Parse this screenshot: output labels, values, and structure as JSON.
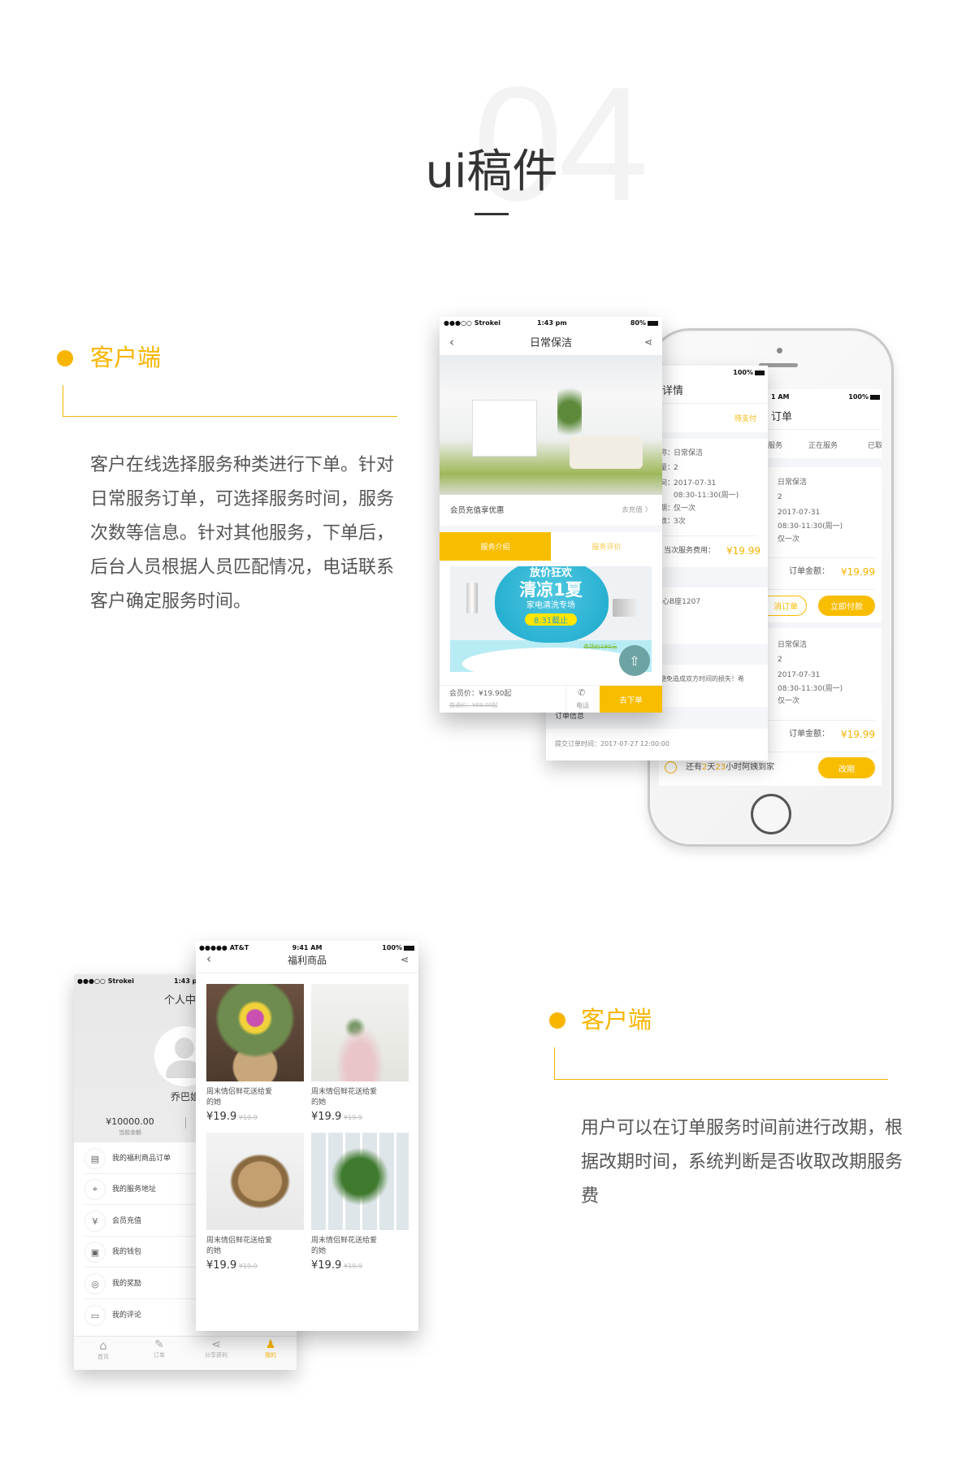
{
  "header": {
    "number": "04",
    "title": "ui稿件"
  },
  "accent_color": "#f8b500",
  "section1": {
    "label": "客户端",
    "description": "客户在线选择服务种类进行下单。针对日常服务订单，可选择服务时间，服务次数等信息。针对其他服务，下单后，后台人员根据人员匹配情况，电话联系客户确定服务时间。"
  },
  "section2": {
    "label": "客户端",
    "description": "用户可以在订单服务时间前进行改期，根据改期时间，系统判断是否收取改期服务费"
  },
  "service_phone": {
    "status": {
      "carrier": "●●●○○ Strokei",
      "time": "1:43 pm",
      "battery": "80%"
    },
    "title": "日常保洁",
    "promo_row": {
      "label": "会员充值享优惠",
      "action": "去充值 〉"
    },
    "tabs": [
      "服务介绍",
      "服务评价"
    ],
    "banner": {
      "line1": "放价狂欢",
      "line2": "清凉1夏",
      "line3": "家电清洗专场",
      "deadline": "8.31截止",
      "market_price": "市场价190元"
    },
    "bottom": {
      "member_price": "会员价：¥19.90起",
      "normal_price": "普通价：¥69.00起",
      "phone_label": "电话",
      "order_button": "去下单"
    }
  },
  "detail_phone": {
    "status": {
      "time": "AM",
      "battery": "100%"
    },
    "title": "详情",
    "state": "待支付",
    "fields": [
      {
        "label": "称：",
        "value": "日常保洁"
      },
      {
        "label": "量：",
        "value": "2"
      },
      {
        "label": "间：",
        "value": "2017-07-31"
      },
      {
        "label": "",
        "value": "08:30-11:30(周一)"
      },
      {
        "label": "期：",
        "value": "仅一次"
      },
      {
        "label": "数：",
        "value": "3次"
      }
    ],
    "fee_label": "当次服务费用：",
    "fee": "¥19.99",
    "address": "心B座1207",
    "notice": "避免造成双方时间的损失！希",
    "order_info_label": "订单信息",
    "submit_time": "提交订单时间：2017-07-27  12:00:00"
  },
  "orders_phone": {
    "status": {
      "time": "1 AM",
      "battery": "100%"
    },
    "title": "订单",
    "tabs": [
      "服务",
      "正在服务",
      "已取"
    ],
    "orders": [
      {
        "fields": [
          "日常保洁",
          "2",
          "2017-07-31",
          "08:30-11:30(周一)",
          "仅一次"
        ],
        "amount_label": "订单金额：",
        "amount": "¥19.99",
        "buttons": [
          "消订单",
          "立即付款"
        ]
      },
      {
        "fields": [
          "日常保洁",
          "2",
          "2017-07-31",
          "08:30-11:30(周一)",
          "仅一次"
        ],
        "amount_label": "订单金额：",
        "amount": "¥19.99",
        "countdown": {
          "pre": "还有",
          "days": "2",
          "mid": "天",
          "hours": "23",
          "post": "小时阿姨到家"
        },
        "button": "改期"
      }
    ]
  },
  "profile_phone": {
    "status": {
      "carrier": "●●●○○ Strokei",
      "time": "1:43 pm"
    },
    "title": "个人中心",
    "name": "乔巴姐",
    "balance": "¥10000.00",
    "balance_label": "当前余额",
    "menu": [
      {
        "icon": "clipboard-icon",
        "label": "我的福利商品订单"
      },
      {
        "icon": "location-icon",
        "label": "我的服务地址"
      },
      {
        "icon": "yen-icon",
        "label": "会员充值"
      },
      {
        "icon": "wallet-icon",
        "label": "我的钱包"
      },
      {
        "icon": "coins-icon",
        "label": "我的奖励"
      },
      {
        "icon": "comment-icon",
        "label": "我的评论"
      }
    ],
    "tabbar": [
      {
        "label": "首页",
        "icon": "home-icon"
      },
      {
        "label": "订单",
        "icon": "order-icon"
      },
      {
        "label": "分享获利",
        "icon": "share-icon"
      },
      {
        "label": "我的",
        "icon": "user-icon",
        "active": true
      }
    ]
  },
  "goods_phone": {
    "status": {
      "carrier": "●●●●● AT&T",
      "time": "9:41 AM",
      "battery": "100%"
    },
    "title": "福利商品",
    "items": [
      {
        "line1": "周末情侣鲜花送给爱",
        "line2": "的她",
        "price": "¥19.9",
        "old_price": "¥19.9"
      },
      {
        "line1": "周末情侣鲜花送给爱",
        "line2": "的她",
        "price": "¥19.9",
        "old_price": "¥19.9"
      },
      {
        "line1": "周末情侣鲜花送给爱",
        "line2": "的她",
        "price": "¥19.9",
        "old_price": "¥19.9"
      },
      {
        "line1": "周末情侣鲜花送给爱",
        "line2": "的她",
        "price": "¥19.9",
        "old_price": "¥19.9"
      }
    ]
  }
}
